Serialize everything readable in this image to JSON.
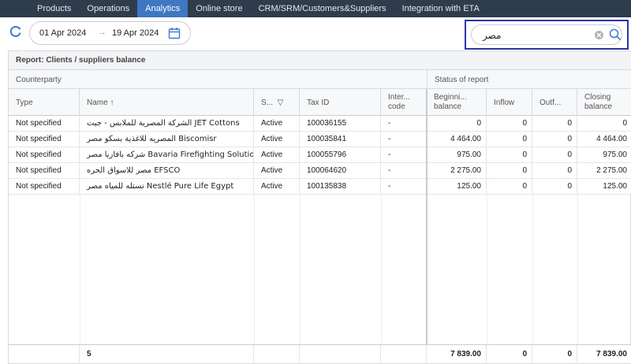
{
  "nav": {
    "items": [
      "Products",
      "Operations",
      "Analytics",
      "Online store",
      "CRM/SRM/Customers&Suppliers",
      "Integration with ETA"
    ],
    "active_index": 2
  },
  "toolbar": {
    "date_from": "01 Apr 2024",
    "date_arrow": "→",
    "date_to": "19 Apr 2024",
    "search_value": "مصر",
    "refresh_icon": "refresh-icon",
    "calendar_icon": "calendar-icon",
    "search_icon": "search-icon",
    "clear_icon": "clear-icon"
  },
  "report": {
    "title": "Report: Clients / suppliers balance",
    "group_counterparty": "Counterparty",
    "group_status": "Status of report",
    "columns": {
      "type": "Type",
      "name": "Name",
      "name_sort": "↑",
      "status": "S...",
      "status_filter": "▽",
      "tax_id": "Tax ID",
      "inter_code_1": "Inter...",
      "inter_code_2": "code",
      "beginning_1": "Beginni...",
      "beginning_2": "balance",
      "inflow": "Inflow",
      "outflow": "Outf...",
      "closing_1": "Closing",
      "closing_2": "balance"
    },
    "rows": [
      {
        "type": "Not specified",
        "name": "الشركة المصرية للملابس - جيت JET Cottons",
        "status": "Active",
        "tax_id": "100036155",
        "inter_code": "-",
        "beginning": "0",
        "inflow": "0",
        "outflow": "0",
        "closing": "0"
      },
      {
        "type": "Not specified",
        "name": "المصريه للاغذية بسكو مصر Biscomisr",
        "status": "Active",
        "tax_id": "100035841",
        "inter_code": "-",
        "beginning": "4 464.00",
        "inflow": "0",
        "outflow": "0",
        "closing": "4 464.00"
      },
      {
        "type": "Not specified",
        "name": "شركه بافاريا مصر Bavaria Firefighting Solutions",
        "status": "Active",
        "tax_id": "100055796",
        "inter_code": "-",
        "beginning": "975.00",
        "inflow": "0",
        "outflow": "0",
        "closing": "975.00"
      },
      {
        "type": "Not specified",
        "name": "مصر للاسواق الحره EFSCO",
        "status": "Active",
        "tax_id": "100064620",
        "inter_code": "-",
        "beginning": "2 275.00",
        "inflow": "0",
        "outflow": "0",
        "closing": "2 275.00"
      },
      {
        "type": "Not specified",
        "name": "نستله للمياه مصر Nestlé Pure Life Egypt",
        "status": "Active",
        "tax_id": "100135838",
        "inter_code": "-",
        "beginning": "125.00",
        "inflow": "0",
        "outflow": "0",
        "closing": "125.00"
      }
    ],
    "footer": {
      "count": "5",
      "beginning": "7 839.00",
      "inflow": "0",
      "outflow": "0",
      "closing": "7 839.00"
    }
  }
}
